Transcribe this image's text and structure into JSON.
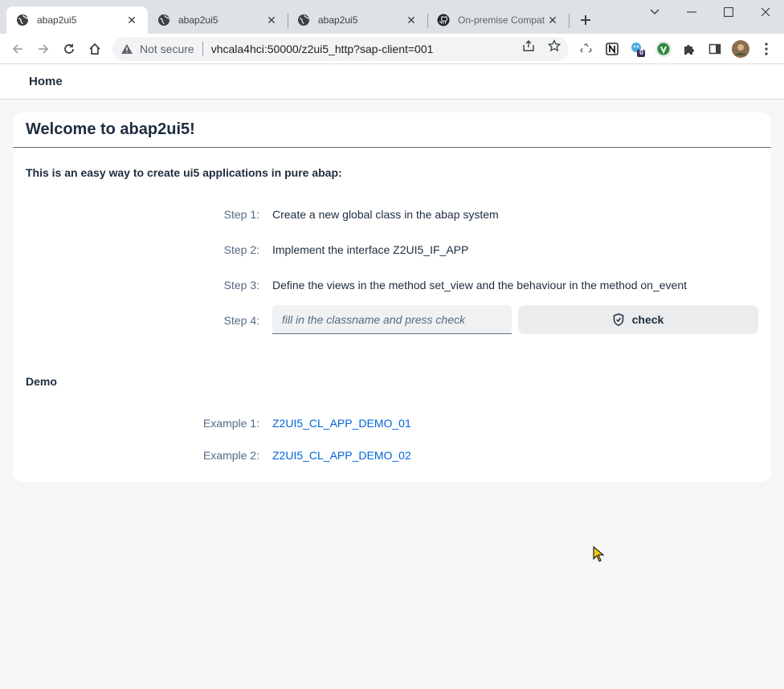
{
  "browser": {
    "tabs": [
      {
        "title": "abap2ui5",
        "active": true,
        "favicon": "globe-icon"
      },
      {
        "title": "abap2ui5",
        "active": false,
        "favicon": "globe-icon"
      },
      {
        "title": "abap2ui5",
        "active": false,
        "favicon": "globe-icon"
      },
      {
        "title": "On-premise Compat",
        "active": false,
        "favicon": "github-icon"
      }
    ],
    "security_label": "Not secure",
    "url": "vhcala4hci:50000/z2ui5_http?sap-client=001",
    "extension_badge": "0"
  },
  "shell": {
    "home_label": "Home"
  },
  "panel": {
    "title": "Welcome to abap2ui5!",
    "intro": "This is an easy way to create ui5 applications in pure abap:",
    "steps": [
      {
        "label": "Step 1:",
        "text": "Create a new global class in the abap system"
      },
      {
        "label": "Step 2:",
        "text": "Implement the interface Z2UI5_IF_APP"
      },
      {
        "label": "Step 3:",
        "text": "Define the views in the method set_view and the behaviour in the method on_event"
      },
      {
        "label": "Step 4:"
      }
    ],
    "classname_input": {
      "placeholder": "fill in the classname and press check",
      "value": ""
    },
    "check_button": "check",
    "demo_heading": "Demo",
    "examples": [
      {
        "label": "Example 1:",
        "link": "Z2UI5_CL_APP_DEMO_01"
      },
      {
        "label": "Example 2:",
        "link": "Z2UI5_CL_APP_DEMO_02"
      }
    ]
  },
  "colors": {
    "link": "#0064d9",
    "text": "#1d2d3e",
    "label": "#556b82",
    "background": "#f5f6f7"
  }
}
